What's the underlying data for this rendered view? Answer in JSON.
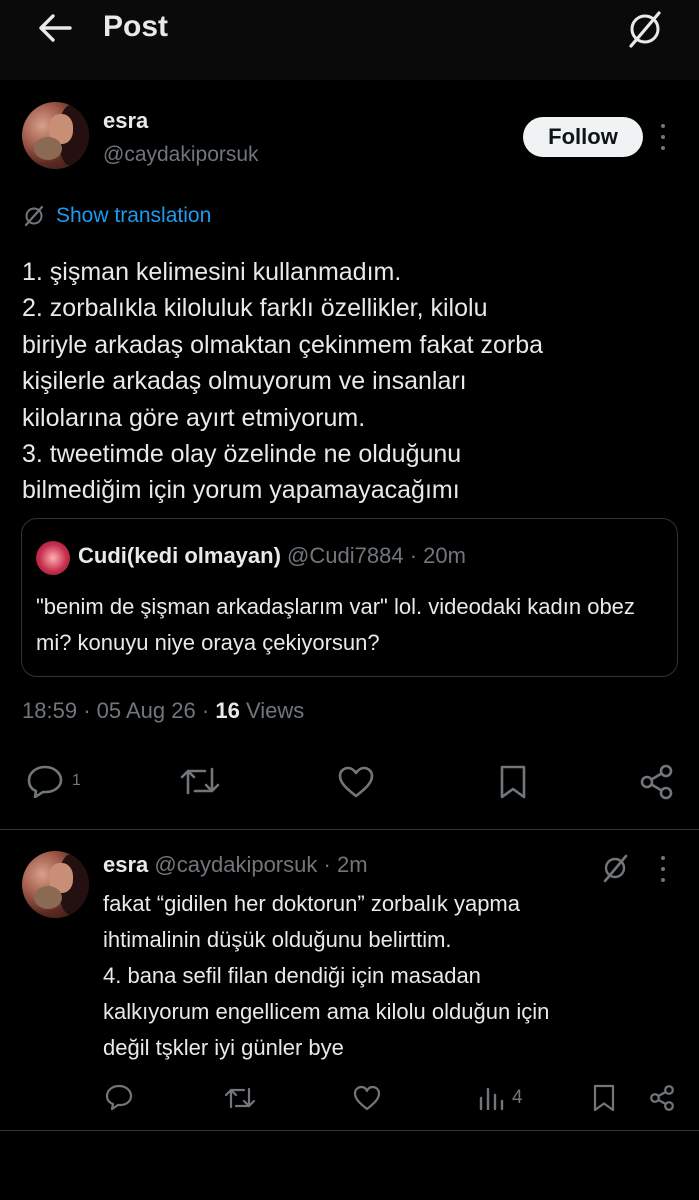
{
  "header": {
    "title": "Post"
  },
  "post": {
    "author_name": "esra",
    "author_handle": "@caydakiporsuk",
    "follow_label": "Follow",
    "translate_label": "Show translation",
    "text_lines": [
      "1. şişman kelimesini kullanmadım.",
      "2. zorbalıkla kiloluluk farklı özellikler, kilolu",
      "biriyle arkadaş olmaktan çekinmem fakat zorba",
      "kişilerle arkadaş olmuyorum ve insanları",
      "kilolarına göre ayırt etmiyorum.",
      "3. tweetimde olay özelinde ne olduğunu",
      "bilmediğim için yorum yapamayacağımı"
    ],
    "quote": {
      "name": "Cudi(kedi olmayan)",
      "handle": "@Cudi7884",
      "time": "20m",
      "text": "\"benim de şişman arkadaşlarım var\" lol. videodaki kadın obez mi? konuyu niye oraya çekiyorsun?"
    },
    "time": "18:59",
    "date": "05 Aug 26",
    "views_count": "16",
    "views_label": "Views",
    "reply_count": "1"
  },
  "reply": {
    "author_name": "esra",
    "author_handle": "@caydakiporsuk",
    "time": "2m",
    "text_lines": [
      "fakat “gidilen her doktorun” zorbalık yapma",
      "ihtimalinin düşük olduğunu belirttim.",
      "4. bana sefil filan dendiği için masadan",
      "kalkıyorum engellicem ama kilolu olduğun için",
      "değil tşkler iyi günler bye"
    ],
    "views_count": "4"
  },
  "colors": {
    "background": "#000000",
    "text": "#e7e9ea",
    "muted": "#71767b",
    "link": "#1d9bf0",
    "border": "#2f3336"
  }
}
